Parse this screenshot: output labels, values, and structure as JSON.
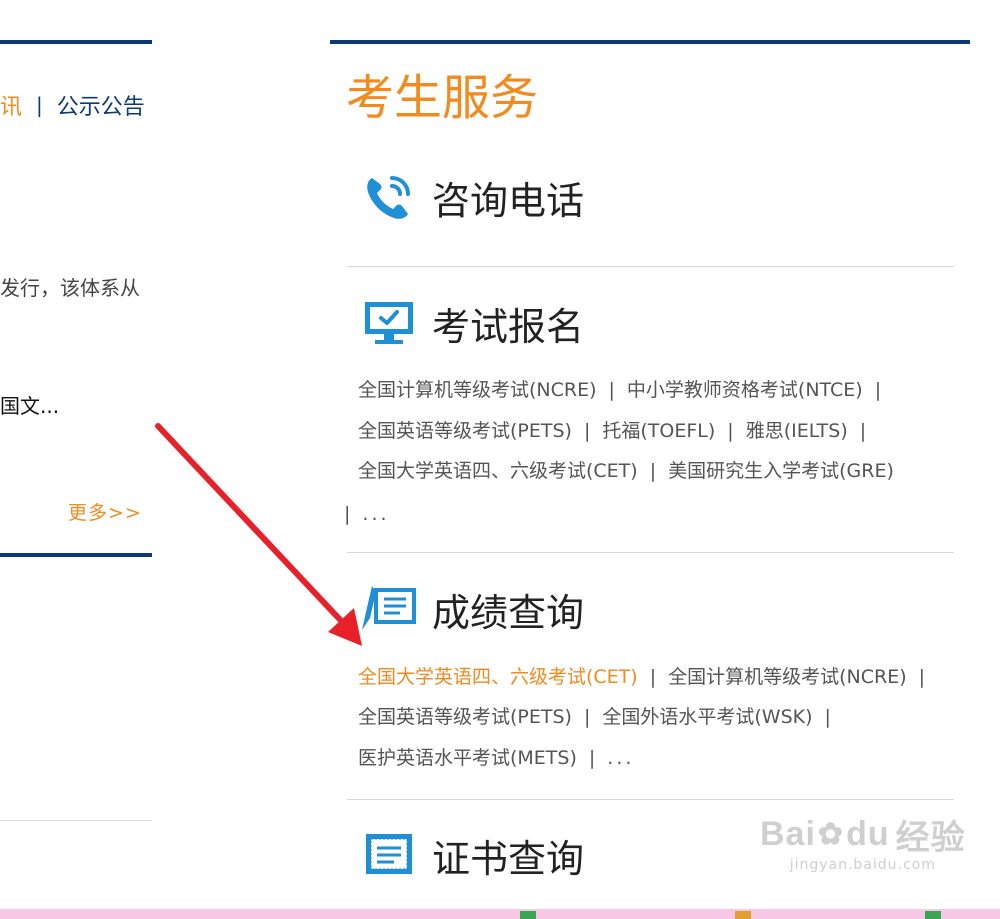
{
  "left_column": {
    "nav_active": "讯",
    "nav_separator": "|",
    "nav_item": "公示公告",
    "snippet_1": "发行，该体系从",
    "snippet_2": "国文...",
    "more_link": "更多>>"
  },
  "panel": {
    "title": "考生服务",
    "sections": {
      "phone": {
        "label": "咨询电话",
        "icon": "phone-icon"
      },
      "registration": {
        "label": "考试报名",
        "icon": "monitor-icon",
        "links": [
          "全国计算机等级考试(NCRE)",
          "中小学教师资格考试(NTCE)",
          "全国英语等级考试(PETS)",
          "托福(TOEFL)",
          "雅思(IELTS)",
          "全国大学英语四、六级考试(CET)",
          "美国研究生入学考试(GRE)"
        ]
      },
      "score": {
        "label": "成绩查询",
        "icon": "score-query-icon",
        "links": [
          "全国大学英语四、六级考试(CET)",
          "全国计算机等级考试(NCRE)",
          "全国英语等级考试(PETS)",
          "全国外语水平考试(WSK)",
          "医护英语水平考试(METS)"
        ]
      },
      "certificate": {
        "label": "证书查询",
        "icon": "certificate-icon"
      }
    },
    "separator": "|",
    "ellipsis": "..."
  },
  "watermark": {
    "brand": "Bai",
    "brand_2": "du",
    "brand_cn": "经验",
    "url": "jingyan.baidu.com"
  },
  "colors": {
    "accent": "#f28a1e",
    "navy": "#0b3a78",
    "icon_blue": "#1f8fd6",
    "arrow_red": "#e8202a"
  }
}
